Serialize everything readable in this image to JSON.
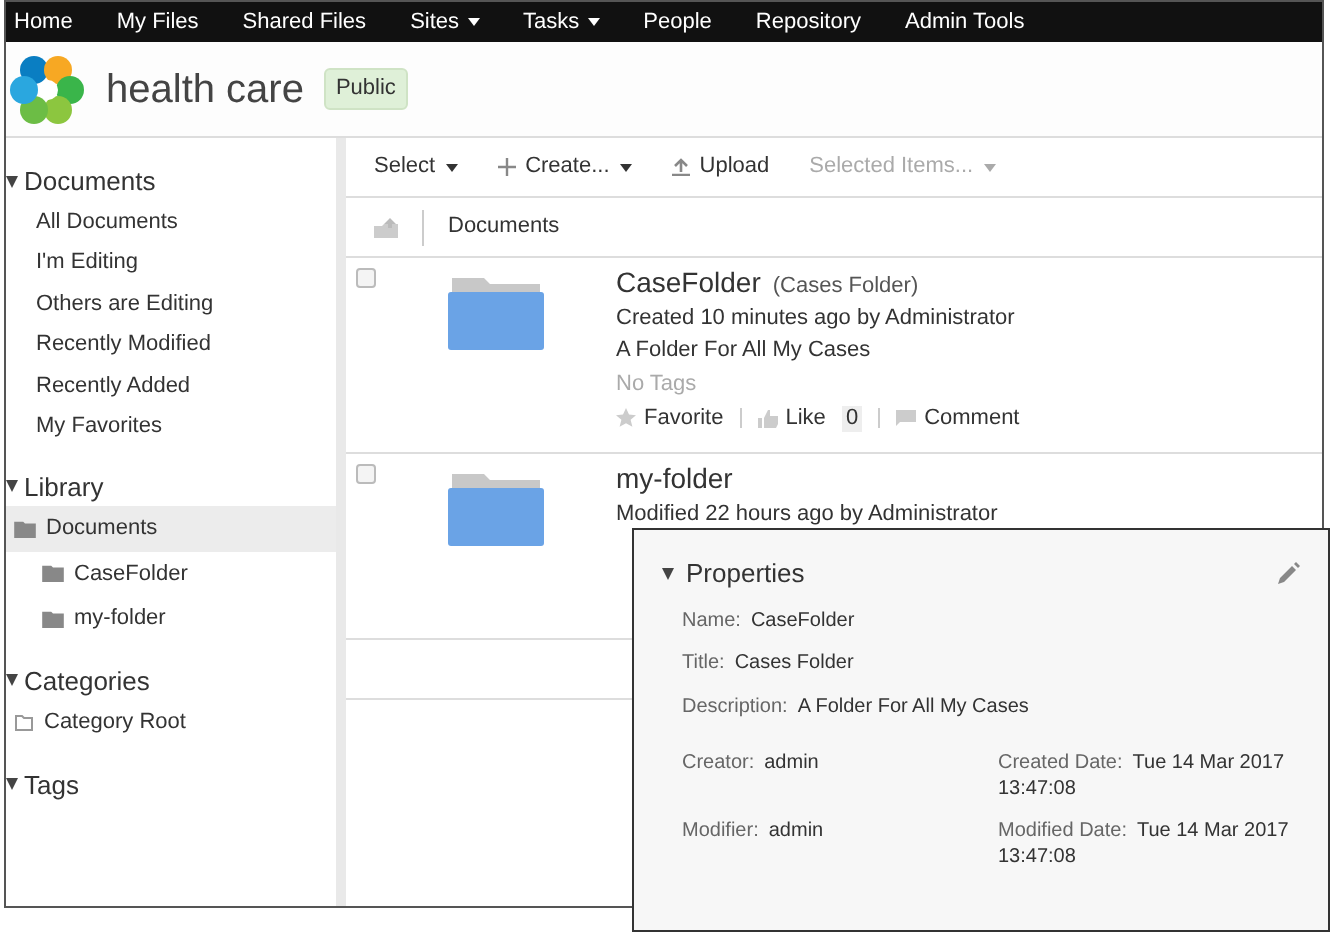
{
  "nav": [
    {
      "label": "Home",
      "dropdown": false
    },
    {
      "label": "My Files",
      "dropdown": false
    },
    {
      "label": "Shared Files",
      "dropdown": false
    },
    {
      "label": "Sites",
      "dropdown": true
    },
    {
      "label": "Tasks",
      "dropdown": true
    },
    {
      "label": "People",
      "dropdown": false
    },
    {
      "label": "Repository",
      "dropdown": false
    },
    {
      "label": "Admin Tools",
      "dropdown": false
    }
  ],
  "site": {
    "name": "health care",
    "visibility": "Public"
  },
  "sidebar": [
    {
      "title": "Documents",
      "expanded": true,
      "items": [
        {
          "label": "All Documents",
          "kind": "link",
          "selected": false
        },
        {
          "label": "I'm Editing",
          "kind": "link",
          "selected": false
        },
        {
          "label": "Others are Editing",
          "kind": "link",
          "selected": false
        },
        {
          "label": "Recently Modified",
          "kind": "link",
          "selected": false
        },
        {
          "label": "Recently Added",
          "kind": "link",
          "selected": false
        },
        {
          "label": "My Favorites",
          "kind": "link",
          "selected": false
        }
      ]
    },
    {
      "title": "Library",
      "expanded": true,
      "items": [
        {
          "label": "Documents",
          "kind": "folder",
          "selected": true,
          "children": [
            {
              "label": "CaseFolder",
              "kind": "folder",
              "selected": false
            },
            {
              "label": "my-folder",
              "kind": "folder",
              "selected": false
            }
          ]
        }
      ]
    },
    {
      "title": "Categories",
      "expanded": true,
      "items": [
        {
          "label": "Category Root",
          "kind": "category",
          "selected": false
        }
      ]
    },
    {
      "title": "Tags",
      "expanded": true
    }
  ],
  "toolbar": [
    {
      "label": "Select",
      "kind": "menu",
      "dropdown": true,
      "disabled": false
    },
    {
      "label": "Create...",
      "kind": "create",
      "dropdown": true,
      "disabled": false
    },
    {
      "label": "Upload",
      "kind": "upload",
      "dropdown": false,
      "disabled": false
    },
    {
      "label": "Selected Items...",
      "kind": "menu",
      "dropdown": true,
      "disabled": true
    }
  ],
  "breadcrumb": "Documents",
  "documents": [
    {
      "name": "CaseFolder",
      "title": "(Cases Folder)",
      "meta": "Created 10 minutes ago by Administrator",
      "description": "A Folder For All My Cases",
      "tags": "No Tags",
      "checked": false,
      "actions": {
        "favorite": "Favorite",
        "like": "Like",
        "likes": "0",
        "comment": "Comment"
      }
    },
    {
      "name": "my-folder",
      "meta": "Modified 22 hours ago by Administrator",
      "checked": false
    }
  ],
  "properties": {
    "title": "Properties",
    "expanded": true,
    "rows": [
      [
        {
          "label": "Name:",
          "value": "CaseFolder"
        }
      ],
      [
        {
          "label": "Title:",
          "value": "Cases Folder"
        }
      ],
      [
        {
          "label": "Description:",
          "value": "A Folder For All My Cases"
        }
      ],
      [
        {
          "label": "Creator:",
          "value": "admin"
        },
        {
          "label": "Created Date:",
          "value": "Tue 14 Mar 2017 13:47:08"
        }
      ],
      [
        {
          "label": "Modifier:",
          "value": "admin"
        },
        {
          "label": "Modified Date:",
          "value": "Tue 14 Mar 2017 13:47:08"
        }
      ]
    ]
  }
}
